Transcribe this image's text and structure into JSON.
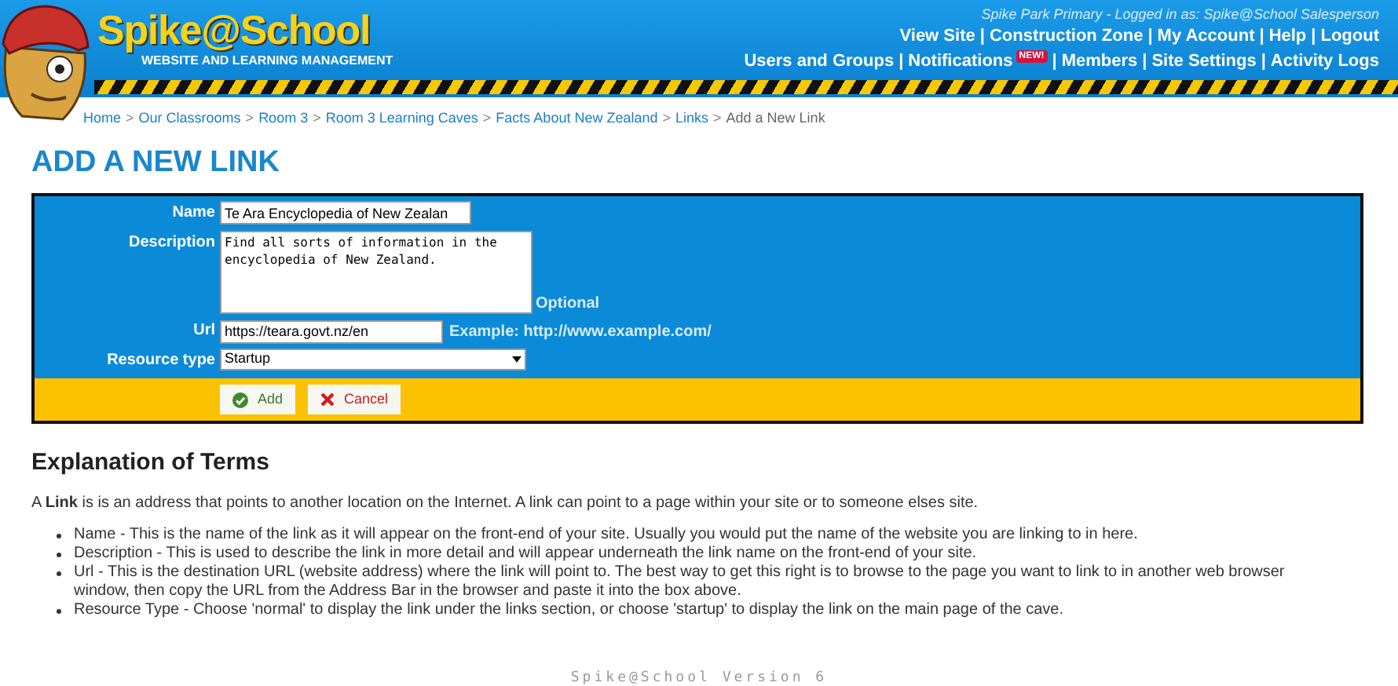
{
  "header": {
    "logo": {
      "name": "Spike@School",
      "tagline": "WEBSITE AND LEARNING MANAGEMENT"
    },
    "login_info": "Spike Park Primary - Logged in as: Spike@School Salesperson",
    "nav_separator": "|",
    "nav_primary": [
      {
        "label": "View Site"
      },
      {
        "label": "Construction Zone"
      },
      {
        "label": "My Account"
      },
      {
        "label": "Help"
      },
      {
        "label": "Logout"
      }
    ],
    "nav_secondary": [
      {
        "label": "Users and Groups"
      },
      {
        "label": "Notifications",
        "badge": "NEW!"
      },
      {
        "label": "Members"
      },
      {
        "label": "Site Settings"
      },
      {
        "label": "Activity Logs"
      }
    ]
  },
  "breadcrumb_separator": ">",
  "breadcrumb": [
    {
      "label": "Home",
      "current": false
    },
    {
      "label": "Our Classrooms",
      "current": false
    },
    {
      "label": "Room 3",
      "current": false
    },
    {
      "label": "Room 3 Learning Caves",
      "current": false
    },
    {
      "label": "Facts About New Zealand",
      "current": false
    },
    {
      "label": "Links",
      "current": false
    },
    {
      "label": "Add a New Link",
      "current": true
    }
  ],
  "page_title": "ADD A NEW LINK",
  "form": {
    "name": {
      "label": "Name",
      "value": "Te Ara Encyclopedia of New Zealan"
    },
    "description": {
      "label": "Description",
      "value": "Find all sorts of information in the encyclopedia of New Zealand.",
      "note": "Optional"
    },
    "url": {
      "label": "Url",
      "value": "https://teara.govt.nz/en",
      "hint": "Example: http://www.example.com/"
    },
    "resource_type": {
      "label": "Resource type",
      "value": "Startup"
    },
    "buttons": [
      {
        "label": "Add",
        "kind": "confirm"
      },
      {
        "label": "Cancel",
        "kind": "cancel"
      }
    ]
  },
  "explanation": {
    "heading": "Explanation of Terms",
    "intro": "A **Link** is is an address that points to another location on the Internet. A link can point to a page within your site or to someone elses site.",
    "items": [
      "Name - This is the name of the link as it will appear on the front-end of your site. Usually you would put the name of the website you are linking to in here.",
      "Description - This is used to describe the link in more detail and will appear underneath the link name on the front-end of your site.",
      "Url - This is the destination URL (website address) where the link will point to. The best way to get this right is to browse to the page you want to link to in another web browser window, then copy the URL from the Address Bar in the browser and paste it into the box above.",
      "Resource Type - Choose 'normal' to display the link under the links section, or choose 'startup' to display the link on the main page of the cave."
    ]
  },
  "footer": "Spike@School Version 6"
}
